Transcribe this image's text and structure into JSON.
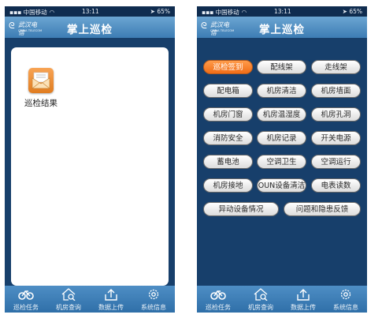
{
  "status_bar": {
    "carrier": "中国移动",
    "time": "13:11",
    "battery": "65%"
  },
  "header": {
    "logo_text": "武汉电信",
    "logo_sub": "CHINA TELECOM",
    "title": "掌上巡检"
  },
  "left_screen": {
    "result_item": {
      "label": "巡检结果",
      "icon": "envelope-icon"
    }
  },
  "right_screen": {
    "buttons": [
      {
        "label": "巡检签到",
        "active": true
      },
      {
        "label": "配线架"
      },
      {
        "label": "走线架"
      },
      {
        "label": "配电箱"
      },
      {
        "label": "机房清洁"
      },
      {
        "label": "机房墙面"
      },
      {
        "label": "机房门窗"
      },
      {
        "label": "机房温湿度"
      },
      {
        "label": "机房孔洞"
      },
      {
        "label": "消防安全"
      },
      {
        "label": "机房记录"
      },
      {
        "label": "开关电源"
      },
      {
        "label": "蓄电池"
      },
      {
        "label": "空调卫生"
      },
      {
        "label": "空调运行"
      },
      {
        "label": "机房接地"
      },
      {
        "label": "OUN设备清洁"
      },
      {
        "label": "电表读数"
      },
      {
        "label": "异动设备情况"
      },
      {
        "label": "问题和隐患反馈"
      }
    ]
  },
  "tab_bar": {
    "tabs": [
      {
        "label": "巡检任务",
        "icon": "bike-icon"
      },
      {
        "label": "机房查询",
        "icon": "house-search-icon"
      },
      {
        "label": "数据上传",
        "icon": "upload-icon"
      },
      {
        "label": "系统信息",
        "icon": "gear-icon"
      }
    ]
  },
  "colors": {
    "background": "#173f6b",
    "header": "#3d7db4",
    "active_button": "#f06d17"
  }
}
